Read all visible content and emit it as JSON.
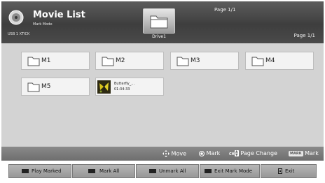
{
  "header": {
    "title": "Movie List",
    "subtitle": "Mark Mode",
    "source_label": "USB 1 XTICK",
    "page_top": "Page 1/1",
    "page_right": "Page 1/1",
    "drive_label": "Drive1"
  },
  "folders": [
    {
      "label": "M1"
    },
    {
      "label": "M2"
    },
    {
      "label": "M3"
    },
    {
      "label": "M4"
    },
    {
      "label": "M5"
    }
  ],
  "video": {
    "name": "Butterfly_...",
    "duration": "01:34:33"
  },
  "hints": {
    "move": "Move",
    "mark": "Mark",
    "ch_badge": "CH",
    "page_change": "Page Change",
    "mark_badge": "MARK",
    "mark2": "Mark"
  },
  "buttons": {
    "play_marked": "Play Marked",
    "mark_all": "Mark All",
    "unmark_all": "Unmark All",
    "exit_mark_mode": "Exit Mark Mode",
    "exit": "Exit"
  },
  "colors": {
    "header_bg": "#4a4a4a",
    "content_bg": "#d3d3d3",
    "tile_bg": "#f3f3f3",
    "hint_bar_bg": "#7c7c7c",
    "button_bg": "#a8a8a8"
  },
  "icons": {
    "source": "disc-icon",
    "drive": "folder-icon",
    "folder": "folder-icon",
    "move": "dpad-icon",
    "mark": "ok-button-icon",
    "exit": "exit-icon"
  }
}
